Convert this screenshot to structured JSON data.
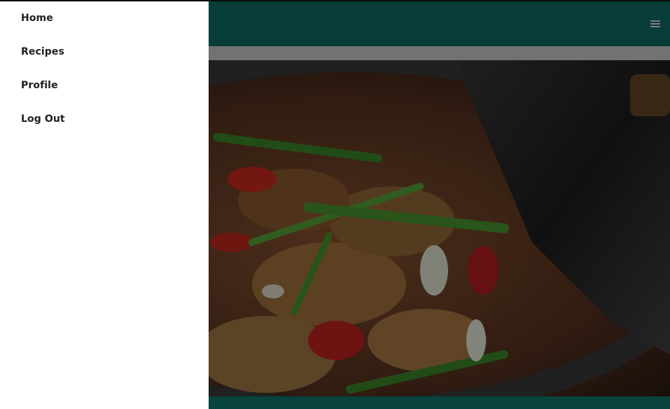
{
  "nav": {
    "items": [
      {
        "label": "Home"
      },
      {
        "label": "Recipes"
      },
      {
        "label": "Profile"
      },
      {
        "label": "Log Out"
      }
    ]
  },
  "header": {
    "menu_icon": "hamburger-menu-icon"
  },
  "hero": {
    "image": "stir-fry-wok-photo"
  },
  "colors": {
    "header": "#0d6e66",
    "footer": "#0f7a72",
    "drawer": "#ffffff",
    "text": "#1f1f1f"
  }
}
